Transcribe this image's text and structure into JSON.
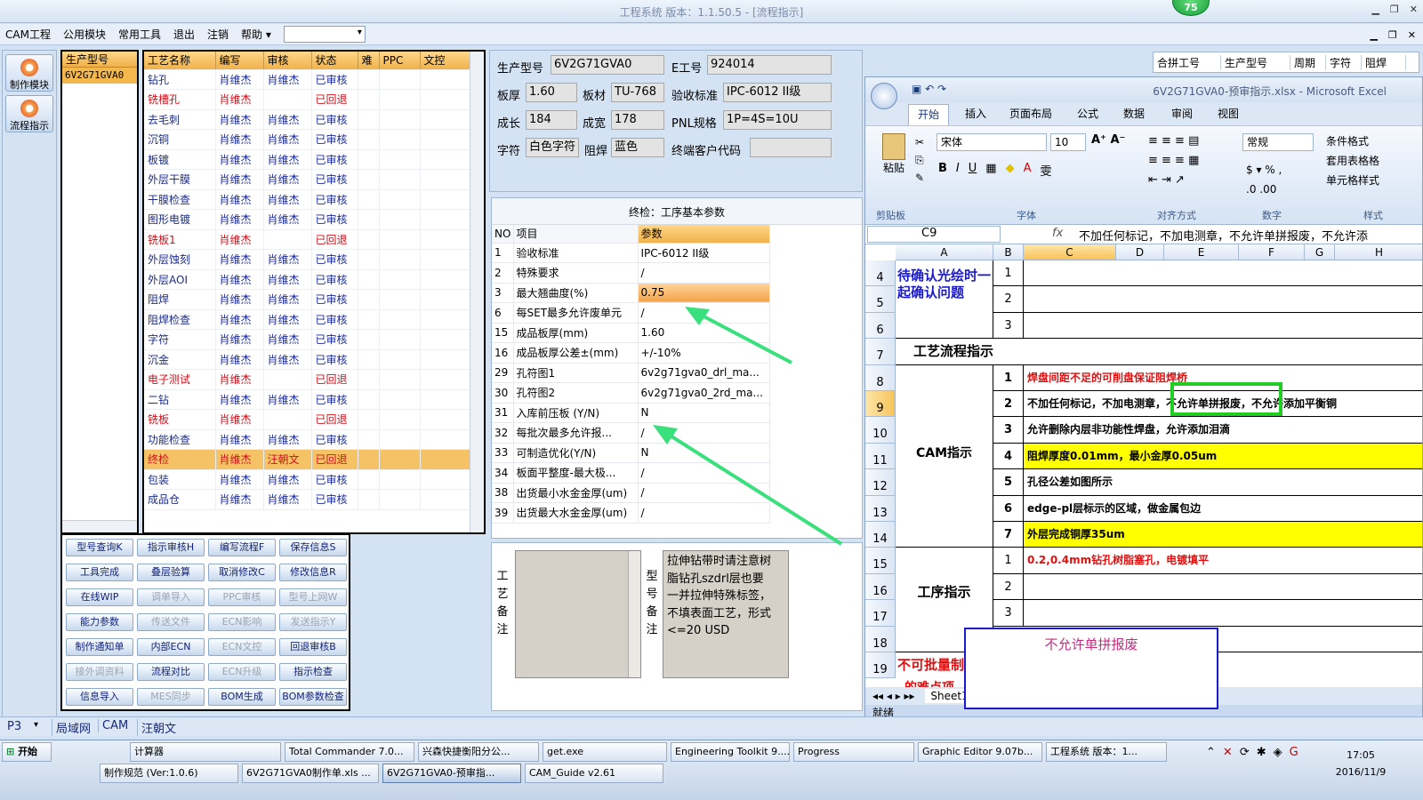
{
  "window": {
    "title": "工程系统  版本：1.1.50.5 - [流程指示]",
    "badge": "75"
  },
  "menu": {
    "items": [
      "CAM工程",
      "公用模块",
      "常用工具",
      "退出",
      "注销",
      "帮助"
    ],
    "help_arrow": "▾",
    "combo_value": ""
  },
  "nav": {
    "items": [
      {
        "label": "制作模块"
      },
      {
        "label": "流程指示"
      }
    ]
  },
  "product_panel": {
    "header": "生产型号",
    "selected": "6V2G71GVA0"
  },
  "process_table": {
    "headers": [
      "工艺名称",
      "编写",
      "审核",
      "状态",
      "难",
      "PPC",
      "文控"
    ],
    "rows": [
      [
        "钻孔",
        "肖维杰",
        "肖维杰",
        "已审核"
      ],
      [
        "铣槽孔",
        "肖维杰",
        "",
        "已回退"
      ],
      [
        "去毛刺",
        "肖维杰",
        "肖维杰",
        "已审核"
      ],
      [
        "沉铜",
        "肖维杰",
        "肖维杰",
        "已审核"
      ],
      [
        "板镀",
        "肖维杰",
        "肖维杰",
        "已审核"
      ],
      [
        "外层干膜",
        "肖维杰",
        "肖维杰",
        "已审核"
      ],
      [
        "干膜检查",
        "肖维杰",
        "肖维杰",
        "已审核"
      ],
      [
        "图形电镀",
        "肖维杰",
        "肖维杰",
        "已审核"
      ],
      [
        "铣板1",
        "肖维杰",
        "",
        "已回退"
      ],
      [
        "外层蚀刻",
        "肖维杰",
        "肖维杰",
        "已审核"
      ],
      [
        "外层AOI",
        "肖维杰",
        "肖维杰",
        "已审核"
      ],
      [
        "阻焊",
        "肖维杰",
        "肖维杰",
        "已审核"
      ],
      [
        "阻焊检查",
        "肖维杰",
        "肖维杰",
        "已审核"
      ],
      [
        "字符",
        "肖维杰",
        "肖维杰",
        "已审核"
      ],
      [
        "沉金",
        "肖维杰",
        "肖维杰",
        "已审核"
      ],
      [
        "电子测试",
        "肖维杰",
        "",
        "已回退"
      ],
      [
        "二钻",
        "肖维杰",
        "肖维杰",
        "已审核"
      ],
      [
        "铣板",
        "肖维杰",
        "",
        "已回退"
      ],
      [
        "功能检查",
        "肖维杰",
        "肖维杰",
        "已审核"
      ],
      [
        "终检",
        "肖维杰",
        "汪朝文",
        "已回退"
      ],
      [
        "包装",
        "肖维杰",
        "肖维杰",
        "已审核"
      ],
      [
        "成品仓",
        "肖维杰",
        "肖维杰",
        "已审核"
      ]
    ]
  },
  "buttons": [
    {
      "label": "型号查询K",
      "enabled": true
    },
    {
      "label": "指示审核H",
      "enabled": true
    },
    {
      "label": "编写流程F",
      "enabled": true
    },
    {
      "label": "保存信息S",
      "enabled": true
    },
    {
      "label": "工具完成",
      "enabled": true
    },
    {
      "label": "叠层验算",
      "enabled": true
    },
    {
      "label": "取消修改C",
      "enabled": true
    },
    {
      "label": "修改信息R",
      "enabled": true
    },
    {
      "label": "在线WIP",
      "enabled": true
    },
    {
      "label": "调单导入",
      "enabled": false
    },
    {
      "label": "PPC审核",
      "enabled": false
    },
    {
      "label": "型号上网W",
      "enabled": false
    },
    {
      "label": "能力参数",
      "enabled": true
    },
    {
      "label": "传送文件",
      "enabled": false
    },
    {
      "label": "ECN影响",
      "enabled": false
    },
    {
      "label": "发送指示Y",
      "enabled": false
    },
    {
      "label": "制作通知单",
      "enabled": true
    },
    {
      "label": "内部ECN",
      "enabled": true
    },
    {
      "label": "ECN文控",
      "enabled": false
    },
    {
      "label": "回退审核B",
      "enabled": true
    },
    {
      "label": "接外调资料",
      "enabled": false
    },
    {
      "label": "流程对比",
      "enabled": true
    },
    {
      "label": "ECN升级",
      "enabled": false
    },
    {
      "label": "指示检查",
      "enabled": true
    },
    {
      "label": "信息导入",
      "enabled": true
    },
    {
      "label": "MES同步",
      "enabled": false
    },
    {
      "label": "BOM生成",
      "enabled": true
    },
    {
      "label": "BOM参数检查",
      "enabled": true
    }
  ],
  "info": {
    "model_label": "生产型号",
    "model": "6V2G71GVA0",
    "eno_label": "E工号",
    "eno": "924014",
    "thick_label": "板厚",
    "thick": "1.60",
    "mat_label": "板材",
    "mat": "TU-768",
    "std_label": "验收标准",
    "std": "IPC-6012 II级",
    "len_label": "成长",
    "len": "184",
    "wid_label": "成宽",
    "wid": "178",
    "pnl_label": "PNL规格",
    "pnl": "1P=4S=10U",
    "char_label": "字符",
    "char": "白色字符",
    "mask_label": "阻焊",
    "mask": "蓝色",
    "cust_label": "终端客户代码",
    "cust": ""
  },
  "params": {
    "caption": "终检：工序基本参数",
    "headers": [
      "NO",
      "项目",
      "参数"
    ],
    "rows": [
      [
        "1",
        "验收标准",
        "IPC-6012 II级"
      ],
      [
        "2",
        "特殊要求",
        "/"
      ],
      [
        "3",
        "最大翘曲度(%)",
        "0.75"
      ],
      [
        "6",
        "每SET最多允许废单元",
        "/"
      ],
      [
        "15",
        "成品板厚(mm)",
        "1.60"
      ],
      [
        "16",
        "成品板厚公差±(mm)",
        "+/-10%"
      ],
      [
        "29",
        "孔符图1",
        "6v2g71gva0_drl_ma..."
      ],
      [
        "30",
        "孔符图2",
        "6v2g71gva0_2rd_ma..."
      ],
      [
        "31",
        "入库前压板 (Y/N)",
        "N"
      ],
      [
        "32",
        "每批次最多允许报...",
        "/"
      ],
      [
        "33",
        "可制造优化(Y/N)",
        "N"
      ],
      [
        "34",
        "板面平整度-最大极...",
        "/"
      ],
      [
        "38",
        "出货最小水金金厚(um)",
        "/"
      ],
      [
        "39",
        "出货最大水金金厚(um)",
        "/"
      ]
    ]
  },
  "notes": {
    "process_label": "工艺备注",
    "model_label": "型号备注",
    "model_text": "拉伸钻带时请注意树脂钻孔szdrl层也要一并拉伸特殊标签，不填表面工艺，形式<=20 USD"
  },
  "right_header": [
    "合拼工号",
    "生产型号",
    "周期",
    "字符",
    "阻焊"
  ],
  "excel": {
    "title": "6V2G71GVA0-预审指示.xlsx - Microsoft Excel",
    "tabs": [
      "开始",
      "插入",
      "页面布局",
      "公式",
      "数据",
      "审阅",
      "视图"
    ],
    "groups": [
      "剪贴板",
      "字体",
      "对齐方式",
      "数字",
      "样式"
    ],
    "font": "宋体",
    "size": "10",
    "numfmt": "常规",
    "styles": [
      "条件格式",
      "套用表格格",
      "单元格样式"
    ],
    "paste_label": "粘贴",
    "cellref": "C9",
    "fx": "fx",
    "formula": "不加任何标记，不加电测章，不允许单拼报废，不允许添",
    "cols": [
      "A",
      "B",
      "C",
      "D",
      "E",
      "F",
      "G",
      "H"
    ],
    "section_confirm": "待确认光绘时一起确认问题",
    "section_flow": "工艺流程指示",
    "section_cam": "CAM指示",
    "section_proc": "工序指示",
    "section_batch1": "不可批量制",
    "section_batch2": "的难点项",
    "cam_items": [
      {
        "n": "1",
        "t": "焊盘间距不足的可削盘保证阻焊桥",
        "style": "red"
      },
      {
        "n": "2",
        "t": "不加任何标记，不加电测章，不允许单拼报废，不允许添加平衡铜",
        "style": "normal"
      },
      {
        "n": "3",
        "t": "允许删除内层非功能性焊盘，允许添加泪滴",
        "style": "bold"
      },
      {
        "n": "4",
        "t": "阻焊厚度0.01mm，最小金厚0.05um",
        "style": "yellow"
      },
      {
        "n": "5",
        "t": "孔径公差如图所示",
        "style": "bold"
      },
      {
        "n": "6",
        "t": "edge-pl层标示的区域，做金属包边",
        "style": "bold"
      },
      {
        "n": "7",
        "t": "外层完成铜厚35um",
        "style": "yellow"
      }
    ],
    "proc_items": [
      {
        "n": "1",
        "t": "0.2,0.4mm钻孔树脂塞孔，电镀填平"
      },
      {
        "n": "2",
        "t": ""
      },
      {
        "n": "3",
        "t": ""
      }
    ],
    "confirm_items": [
      "1",
      "2",
      "3"
    ],
    "sheet": "Sheet1",
    "status": "就绪",
    "popup": "不允许单拼报废"
  },
  "bottom": {
    "page": "P3",
    "items": [
      "局域网",
      "CAM",
      "汪朝文"
    ]
  },
  "taskbar": {
    "start": "开始",
    "row1": [
      "计算器",
      "Total Commander 7.0...",
      "兴森快捷衡阳分公...",
      "get.exe",
      "Engineering Toolkit 9....",
      "Progress",
      "Graphic Editor 9.07b...",
      "工程系统  版本：1..."
    ],
    "row2": [
      "制作规范 (Ver:1.0.6)",
      "6V2G71GVA0制作单.xls ...",
      "6V2G71GVA0-预审指...",
      "CAM_Guide v2.61"
    ],
    "time": "17:05",
    "date": "2016/11/9"
  },
  "colors": {
    "accent": "#f0b14a",
    "arrow": "#39e07c",
    "highlight_box": "#22cc22",
    "popup_border": "#1a1acc"
  }
}
